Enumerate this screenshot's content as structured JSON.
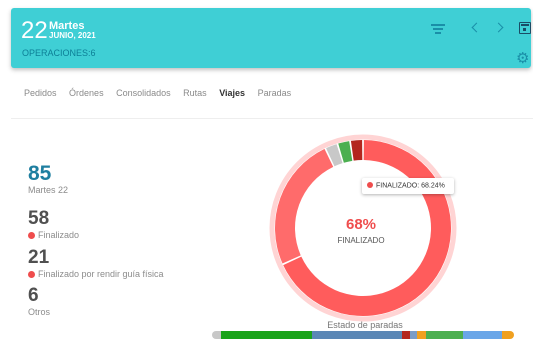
{
  "header": {
    "day_number": "22",
    "day_name": "Martes",
    "month_year": "JUNIO, 2021",
    "operations": "OPERACIONES:6",
    "icons": [
      "filter-icon",
      "chevron-left-icon",
      "chevron-right-icon",
      "calendar-icon",
      "gear-icon"
    ]
  },
  "tabs": [
    {
      "label": "Pedidos"
    },
    {
      "label": "Órdenes"
    },
    {
      "label": "Consolidados"
    },
    {
      "label": "Rutas"
    },
    {
      "label": "Viajes",
      "active": true
    },
    {
      "label": "Paradas"
    }
  ],
  "stats": {
    "total": {
      "value": "85",
      "label": "Martes 22"
    },
    "finalizado": {
      "value": "58",
      "label": "Finalizado"
    },
    "por_rendir": {
      "value": "21",
      "label": "Finalizado por rendir guía física"
    },
    "otros": {
      "value": "6",
      "label": "Otros"
    }
  },
  "donut": {
    "center_value": "68%",
    "center_label": "FINALIZADO",
    "tooltip": "FINALIZADO: 68.24%",
    "segments": [
      {
        "name": "Finalizado",
        "value": 68.24,
        "color": "#ff5c5c"
      },
      {
        "name": "Finalizado por rendir guía física",
        "value": 24.71,
        "color": "#ff6b6b"
      },
      {
        "name": "gris",
        "value": 2.35,
        "color": "#c8c8c8"
      },
      {
        "name": "verde",
        "value": 2.35,
        "color": "#4caf50"
      },
      {
        "name": "rojo oscuro",
        "value": 2.35,
        "color": "#b3261e"
      }
    ]
  },
  "paradas": {
    "title": "Estado de paradas",
    "segments": [
      {
        "value": 3,
        "color": "#c8c8c8"
      },
      {
        "value": 30,
        "color": "#1aa31a"
      },
      {
        "value": 30,
        "color": "#5b87b5"
      },
      {
        "value": 2.5,
        "color": "#b3261e"
      },
      {
        "value": 2.5,
        "color": "#7a9cc6"
      },
      {
        "value": 3,
        "color": "#f0a020"
      },
      {
        "value": 12,
        "color": "#4caf50"
      },
      {
        "value": 13,
        "color": "#6aa6e8"
      },
      {
        "value": 4,
        "color": "#f0a020"
      }
    ]
  }
}
